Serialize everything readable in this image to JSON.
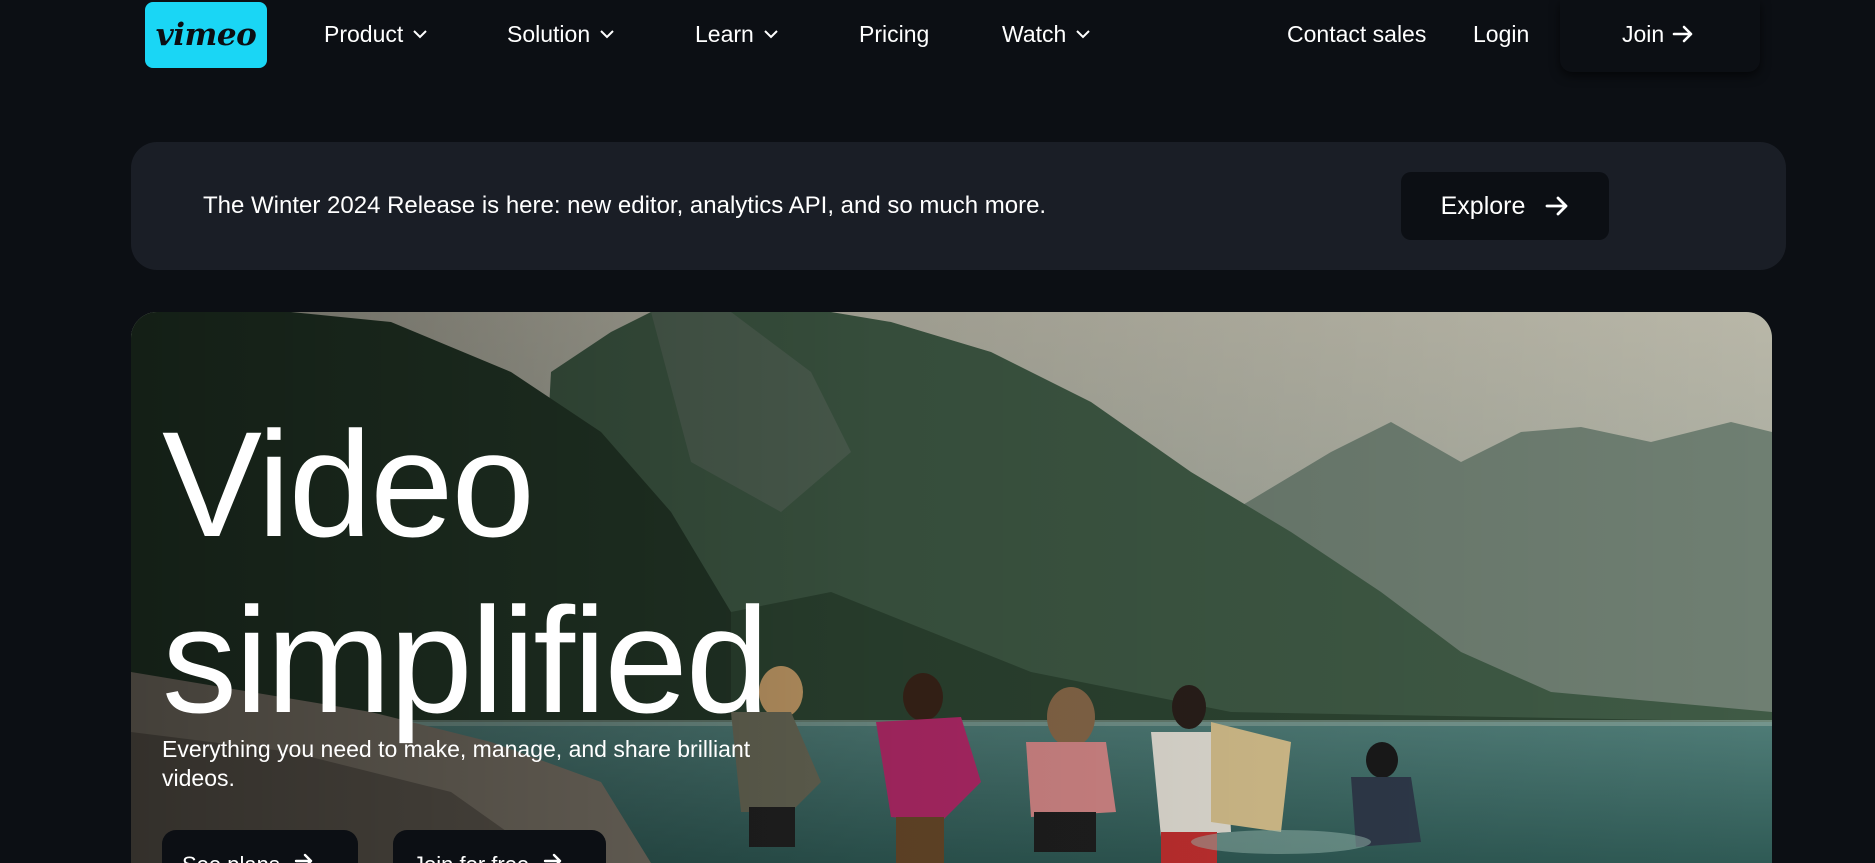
{
  "brand": {
    "logo_text": "vimeo",
    "accent": "#1ad6f5"
  },
  "nav": {
    "items": [
      {
        "label": "Product",
        "has_dropdown": true
      },
      {
        "label": "Solution",
        "has_dropdown": true
      },
      {
        "label": "Learn",
        "has_dropdown": true
      },
      {
        "label": "Pricing",
        "has_dropdown": false
      },
      {
        "label": "Watch",
        "has_dropdown": true
      }
    ],
    "contact_sales": "Contact sales",
    "login": "Login",
    "join": "Join"
  },
  "banner": {
    "text": "The Winter 2024 Release is here: new editor, analytics API, and so much more.",
    "button": "Explore"
  },
  "hero": {
    "title_line1": "Video",
    "title_line2": "simplified",
    "subtitle": "Everything you need to make, manage, and share brilliant videos.",
    "primary_button": "See plans",
    "secondary_button": "Join for free"
  },
  "icons": {
    "dropdown": "chevron-down-icon",
    "arrow": "arrow-right-icon"
  },
  "colors": {
    "background": "#0c0f14",
    "banner": "#1a1e26",
    "text": "#ffffff"
  }
}
